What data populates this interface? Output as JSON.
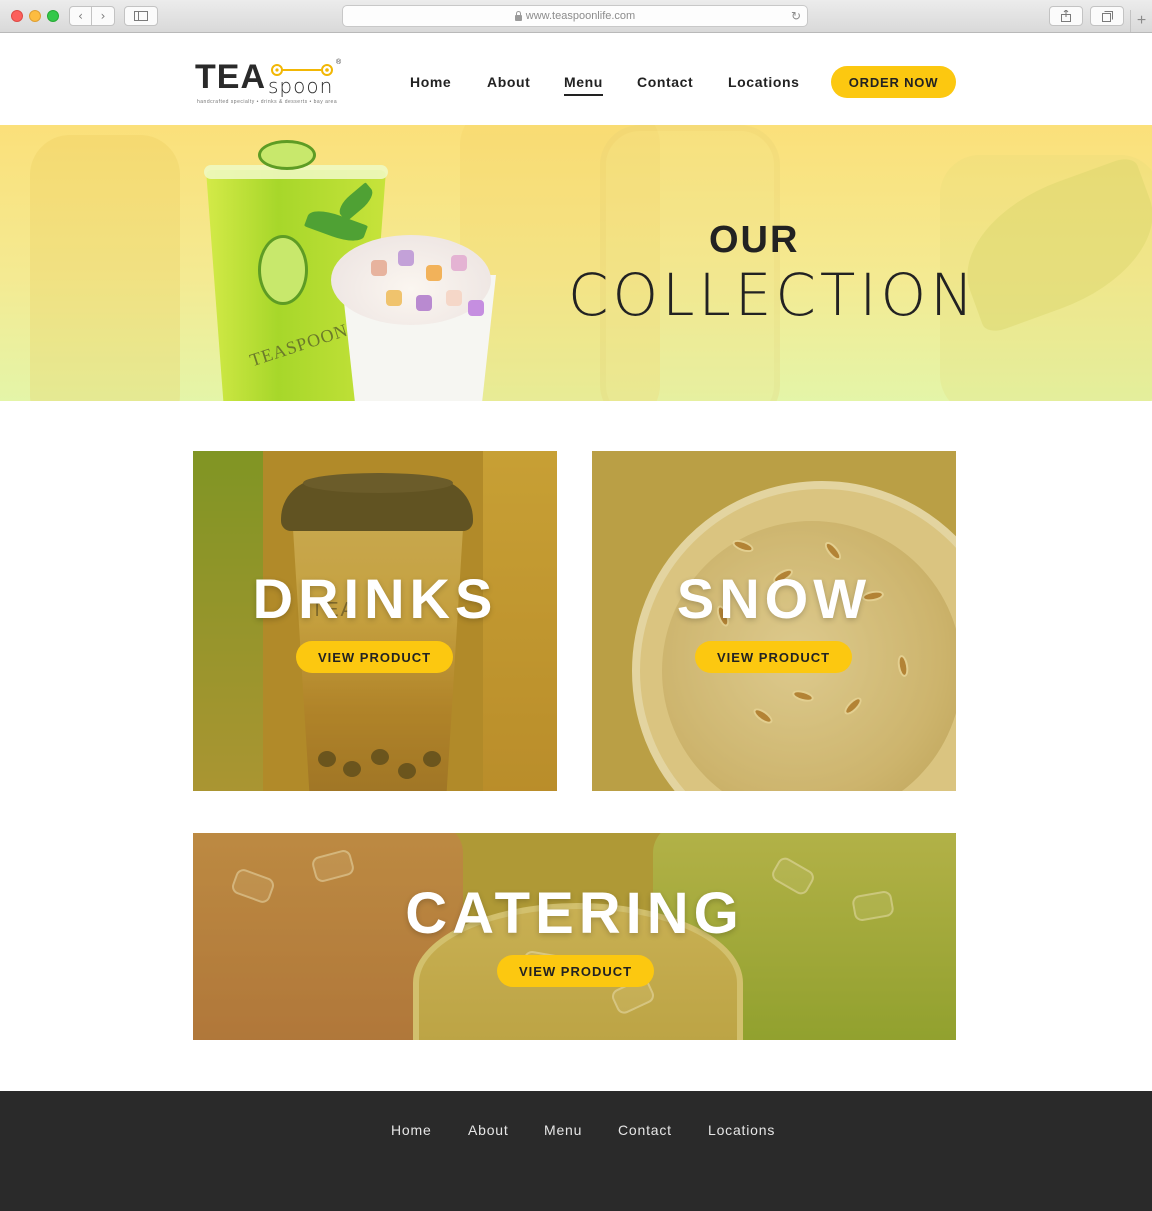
{
  "browser": {
    "url": "www.teaspoonlife.com",
    "icons": {
      "back": "chevron-left-icon",
      "forward": "chevron-right-icon",
      "sidebar": "sidebar-icon",
      "lock": "lock-icon",
      "reload": "reload-icon",
      "share": "share-icon",
      "tabs": "tabs-icon",
      "new_tab": "plus-icon"
    }
  },
  "brand": {
    "logo_word": "TEA",
    "logo_spoon_word": "spoon",
    "registered": "®",
    "tagline": "handcrafted specialty • drinks & desserts • bay area",
    "accent": "#fcc810"
  },
  "nav": {
    "items": [
      {
        "label": "Home"
      },
      {
        "label": "About"
      },
      {
        "label": "Menu"
      },
      {
        "label": "Contact"
      },
      {
        "label": "Locations"
      }
    ],
    "active": "Menu",
    "cta": "ORDER NOW"
  },
  "hero": {
    "line1": "OUR",
    "line2": "COLLECTION",
    "cup_brand": "TEASPOON"
  },
  "collections": [
    {
      "title": "DRINKS",
      "button": "VIEW PRODUCT",
      "cup_brand": "TEA"
    },
    {
      "title": "SNOW",
      "button": "VIEW PRODUCT"
    },
    {
      "title": "CATERING",
      "button": "VIEW PRODUCT"
    }
  ],
  "footer": {
    "items": [
      {
        "label": "Home"
      },
      {
        "label": "About"
      },
      {
        "label": "Menu"
      },
      {
        "label": "Contact"
      },
      {
        "label": "Locations"
      }
    ],
    "background": "#2a2a2a"
  }
}
